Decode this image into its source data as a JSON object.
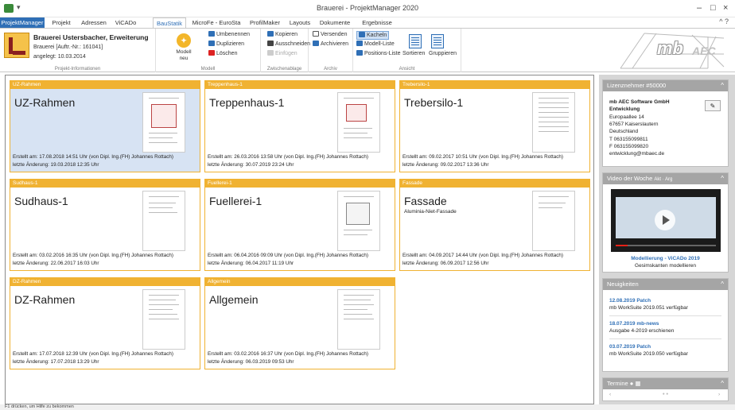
{
  "window": {
    "title": "Brauerei - ProjektManager 2020",
    "quick_access": "▾",
    "min": "–",
    "max": "□",
    "close": "×"
  },
  "tabs": [
    {
      "label": "ProjektManager"
    },
    {
      "label": "Projekt"
    },
    {
      "label": "Adressen"
    },
    {
      "label": "ViCADo"
    },
    {
      "label": "BauStatik"
    },
    {
      "label": "MicroFe - EuroSta"
    },
    {
      "label": "ProfilMaker"
    },
    {
      "label": "Layouts"
    },
    {
      "label": "Dokumente"
    },
    {
      "label": "Ergebnisse"
    }
  ],
  "ribbon": {
    "project": {
      "name": "Brauerei Ustersbacher, Erweiterung",
      "client": "Brauerei [Auftr.-Nr.: 161041]",
      "created": "angelegt: 10.03.2014",
      "group": "Projekt-Informationen"
    },
    "modell": {
      "button": "Modell neu",
      "group": "Modell",
      "rename": "Umbenennen",
      "duplicate": "Duplizieren",
      "delete": "Löschen"
    },
    "clipboard": {
      "copy": "Kopieren",
      "cut": "Ausschneiden",
      "paste": "Einfügen",
      "group": "Zwischenablage"
    },
    "archive": {
      "send": "Versenden",
      "archive": "Archivieren",
      "group": "Archiv"
    },
    "view": {
      "cards": "Kacheln",
      "model_list": "Modell-Liste",
      "pos_list": "Positions-Liste",
      "sort": "Sortieren",
      "groups": "Gruppieren",
      "group": "Ansicht"
    },
    "logo": {
      "mb": "mb",
      "aec": "AEC"
    }
  },
  "cards": [
    {
      "header": "UZ-Rahmen",
      "title": "UZ-Rahmen",
      "subtitle": "",
      "created": "Erstellt am: 17.08.2018 14:51 Uhr (von Dipl. Ing.(FH) Johannes Rottach)",
      "changed": "letzte Änderung: 19.03.2018 12:35 Uhr"
    },
    {
      "header": "Treppenhaus-1",
      "title": "Treppenhaus-1",
      "subtitle": "",
      "created": "Erstellt am: 26.03.2016 13:58 Uhr (von Dipl. Ing.(FH) Johannes Rottach)",
      "changed": "letzte Änderung: 30.07.2019 23:24 Uhr"
    },
    {
      "header": "Trebersilo-1",
      "title": "Trebersilo-1",
      "subtitle": "",
      "created": "Erstellt am: 09.02.2017 10:51 Uhr (von Dipl. Ing.(FH) Johannes Rottach)",
      "changed": "letzte Änderung: 09.02.2017 13:36 Uhr"
    },
    {
      "header": "Sudhaus-1",
      "title": "Sudhaus-1",
      "subtitle": "",
      "created": "Erstellt am: 03.02.2016 16:35 Uhr (von Dipl. Ing.(FH) Johannes Rottach)",
      "changed": "letzte Änderung: 22.06.2017 16:03 Uhr"
    },
    {
      "header": "Fuellerei-1",
      "title": "Fuellerei-1",
      "subtitle": "",
      "created": "Erstellt am: 06.04.2016 09:09 Uhr (von Dipl. Ing.(FH) Johannes Rottach)",
      "changed": "letzte Änderung: 06.04.2017 11:19 Uhr"
    },
    {
      "header": "Fassade",
      "title": "Fassade",
      "subtitle": "Aluminia-Niet-Fassade",
      "created": "Erstellt am: 04.09.2017 14:44 Uhr (von Dipl. Ing.(FH) Johannes Rottach)",
      "changed": "letzte Änderung: 06.09.2017 12:56 Uhr"
    },
    {
      "header": "DZ-Rahmen",
      "title": "DZ-Rahmen",
      "subtitle": "",
      "created": "Erstellt am: 17.07.2018 12:39 Uhr (von Dipl. Ing.(FH) Johannes Rottach)",
      "changed": "letzte Änderung: 17.07.2018 13:29 Uhr"
    },
    {
      "header": "Allgemein",
      "title": "Allgemein",
      "subtitle": "",
      "created": "Erstellt am: 03.02.2016 16:37 Uhr (von Dipl. Ing.(FH) Johannes Rottach)",
      "changed": "letzte Änderung: 06.03.2019 09:53 Uhr"
    }
  ],
  "sidebar": {
    "license": {
      "header": "Lizenznehmer #50000",
      "company": "mb AEC Software GmbH",
      "dept": "Entwicklung",
      "street": "Europaallee 14",
      "city": "67657 Kaiserslautern",
      "country": "Deutschland",
      "tel": "T 063155099811",
      "fax": "F 063155099820",
      "email": "entwicklung@mbaec.de"
    },
    "video": {
      "header": "Video der Woche",
      "tabs": "Akt · Arg",
      "title": "Modellierung - ViCADo 2019",
      "desc": "Gesimskanten modellieren",
      "progress": 0.12
    },
    "news": {
      "header": "Neuigkeiten",
      "items": [
        {
          "title": "12.08.2019 Patch",
          "text": "mb WorkSuite 2019.051 verfügbar"
        },
        {
          "title": "18.07.2019 mb-news",
          "text": "Ausgabe 4-2019 erschienen"
        },
        {
          "title": "03.07.2019 Patch",
          "text": "mb WorkSuite 2019.050 verfügbar"
        }
      ]
    },
    "termine": {
      "header": "Termine",
      "prev": "‹",
      "next": "›",
      "dots": "● ●"
    }
  },
  "status": "F1 drücken, um Hilfe zu bekommen",
  "colors": {
    "accent": "#2f6fb6",
    "card_border": "#f0b232",
    "selected": "#d7e3f3"
  }
}
